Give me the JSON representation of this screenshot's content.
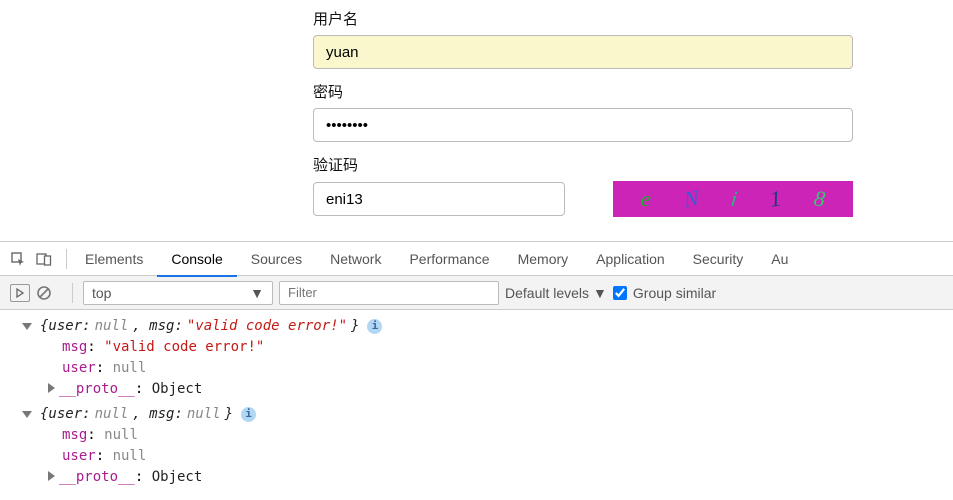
{
  "form": {
    "username_label": "用户名",
    "username_value": "yuan",
    "password_label": "密码",
    "password_value": "••••••••",
    "captcha_label": "验证码",
    "captcha_value": "eni13",
    "captcha_chars": [
      "e",
      "N",
      "i",
      "1",
      "8"
    ],
    "captcha_colors": [
      "#16b22a",
      "#2a62d6",
      "#24b880",
      "#1a3c7a",
      "#39c871"
    ]
  },
  "devtools": {
    "tabs": [
      "Elements",
      "Console",
      "Sources",
      "Network",
      "Performance",
      "Memory",
      "Application",
      "Security",
      "Au"
    ],
    "active_tab": "Console",
    "context": "top",
    "filter_placeholder": "Filter",
    "levels_label": "Default levels",
    "group_label": "Group similar"
  },
  "console": {
    "objects": [
      {
        "summary_prefix": "{user: ",
        "summary_user": "null",
        "summary_mid": ", msg: ",
        "summary_msg": "\"valid code error!\"",
        "summary_suffix": "}",
        "msg_is_string": true,
        "props": [
          {
            "key": "msg",
            "val": "\"valid code error!\"",
            "is_string": true
          },
          {
            "key": "user",
            "val": "null",
            "is_string": false
          }
        ],
        "proto_key": "__proto__",
        "proto_val": "Object"
      },
      {
        "summary_prefix": "{user: ",
        "summary_user": "null",
        "summary_mid": ", msg: ",
        "summary_msg": "null",
        "summary_suffix": "}",
        "msg_is_string": false,
        "props": [
          {
            "key": "msg",
            "val": "null",
            "is_string": false
          },
          {
            "key": "user",
            "val": "null",
            "is_string": false
          }
        ],
        "proto_key": "__proto__",
        "proto_val": "Object"
      }
    ]
  }
}
